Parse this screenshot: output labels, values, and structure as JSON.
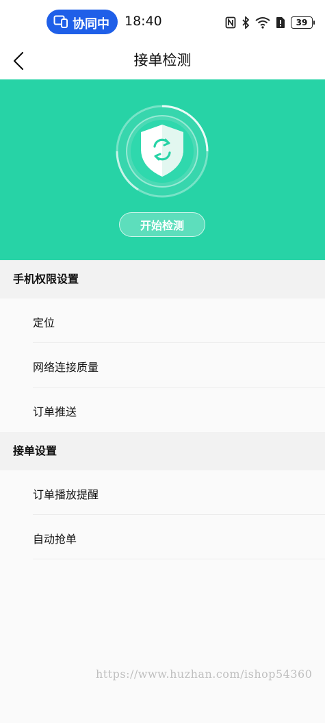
{
  "status_bar": {
    "collab_label": "协同中",
    "time": "18:40",
    "battery": "39",
    "icons": [
      "nfc-icon",
      "bluetooth-icon",
      "wifi-icon",
      "sim-alert-icon",
      "battery-icon"
    ]
  },
  "nav": {
    "title": "接单检测",
    "back_icon": "chevron-left-icon"
  },
  "hero": {
    "shield_icon": "shield-refresh-icon",
    "start_button": "开始检测",
    "background": "#27d3a6"
  },
  "sections": [
    {
      "title": "手机权限设置",
      "items": [
        "定位",
        "网络连接质量",
        "订单推送"
      ]
    },
    {
      "title": "接单设置",
      "items": [
        "订单播放提醒",
        "自动抢单"
      ]
    }
  ],
  "watermark": "https://www.huzhan.com/ishop54360"
}
